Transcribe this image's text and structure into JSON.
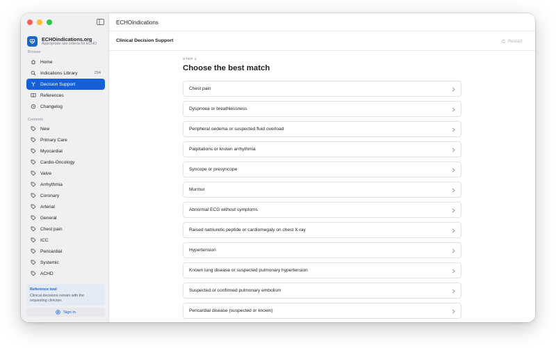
{
  "app": {
    "window_title": "ECHOindications"
  },
  "brand": {
    "name": "ECHOindications.org",
    "subtitle": "Appropriate use criteria for ECHO"
  },
  "sidebar": {
    "browse_label": "Browse",
    "browse_items": [
      {
        "label": "Home",
        "icon": "home-icon"
      },
      {
        "label": "Indications Library",
        "icon": "search-icon",
        "count": "294"
      },
      {
        "label": "Decision Support",
        "icon": "branch-icon",
        "active": true
      },
      {
        "label": "References",
        "icon": "book-icon"
      },
      {
        "label": "Changelog",
        "icon": "history-icon"
      }
    ],
    "contexts_label": "Contexts",
    "context_items": [
      {
        "label": "New"
      },
      {
        "label": "Primary Care"
      },
      {
        "label": "Myocardial"
      },
      {
        "label": "Cardio-Oncology"
      },
      {
        "label": "Valve"
      },
      {
        "label": "Arrhythmia"
      },
      {
        "label": "Coronary"
      },
      {
        "label": "Arterial"
      },
      {
        "label": "General"
      },
      {
        "label": "Chest pain"
      },
      {
        "label": "ICC"
      },
      {
        "label": "Pericardial"
      },
      {
        "label": "Systemic"
      },
      {
        "label": "ACHD"
      }
    ],
    "reference_card": {
      "title": "Reference tool",
      "body": "Clinical decisions remain with the requesting clinician."
    },
    "signin_label": "Sign in"
  },
  "toolbar": {
    "title": "Clinical Decision Support",
    "restart_label": "Restart"
  },
  "main": {
    "step_label": "STEP 1",
    "heading": "Choose the best match",
    "options": [
      "Chest pain",
      "Dyspnoea or breathlessness",
      "Peripheral oedema or suspected fluid overload",
      "Palpitations or known arrhythmia",
      "Syncope or presyncope",
      "Murmur",
      "Abnormal ECG without symptoms",
      "Raised natriuretic peptide or cardiomegaly on chest X-ray",
      "Hypertension",
      "Known lung disease or suspected pulmonary hypertension",
      "Suspected or confirmed pulmonary embolism",
      "Pericardial disease (suspected or known)"
    ]
  },
  "colors": {
    "accent": "#1560d6",
    "sidebar_bg": "#f0f0f2",
    "ref_card_bg": "#e3ebf7"
  }
}
